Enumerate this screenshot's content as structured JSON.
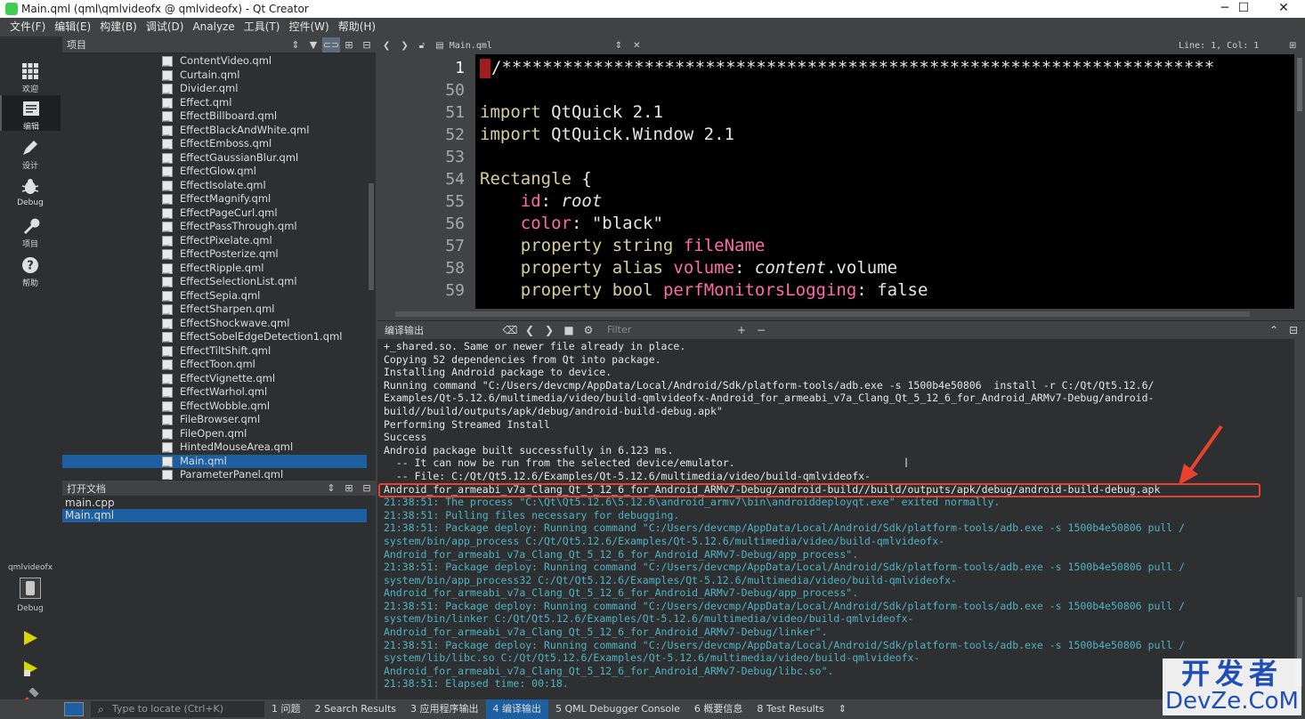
{
  "window": {
    "title": "Main.qml (qml\\qmlvideofx @ qmlvideofx) - Qt Creator",
    "minimize": "─",
    "maximize": "☐",
    "close": "✕"
  },
  "menu": [
    "文件(F)",
    "编辑(E)",
    "构建(B)",
    "调试(D)",
    "Analyze",
    "工具(T)",
    "控件(W)",
    "帮助(H)"
  ],
  "modes": [
    {
      "label": "欢迎",
      "icon": "welcome-grid-icon"
    },
    {
      "label": "编辑",
      "icon": "edit-document-icon"
    },
    {
      "label": "设计",
      "icon": "design-pen-icon"
    },
    {
      "label": "Debug",
      "icon": "debug-bug-icon"
    },
    {
      "label": "项目",
      "icon": "projects-wrench-icon"
    },
    {
      "label": "帮助",
      "icon": "help-question-icon"
    }
  ],
  "kit": {
    "project": "qmlvideofx",
    "mode": "Debug"
  },
  "projects_panel": {
    "title": "项目",
    "files": [
      "ContentVideo.qml",
      "Curtain.qml",
      "Divider.qml",
      "Effect.qml",
      "EffectBillboard.qml",
      "EffectBlackAndWhite.qml",
      "EffectEmboss.qml",
      "EffectGaussianBlur.qml",
      "EffectGlow.qml",
      "EffectIsolate.qml",
      "EffectMagnify.qml",
      "EffectPageCurl.qml",
      "EffectPassThrough.qml",
      "EffectPixelate.qml",
      "EffectPosterize.qml",
      "EffectRipple.qml",
      "EffectSelectionList.qml",
      "EffectSepia.qml",
      "EffectSharpen.qml",
      "EffectShockwave.qml",
      "EffectSobelEdgeDetection1.qml",
      "EffectTiltShift.qml",
      "EffectToon.qml",
      "EffectVignette.qml",
      "EffectWarhol.qml",
      "EffectWobble.qml",
      "FileBrowser.qml",
      "FileOpen.qml",
      "HintedMouseArea.qml",
      "Main.qml",
      "ParameterPanel.qml"
    ],
    "selected": "Main.qml"
  },
  "open_docs": {
    "title": "打开文档",
    "docs": [
      "main.cpp",
      "Main.qml"
    ],
    "selected": "Main.qml"
  },
  "editor": {
    "file": "Main.qml",
    "position": "Line: 1, Col: 1",
    "line_numbers": [
      "1",
      "50",
      "51",
      "52",
      "53",
      "54",
      "55",
      "56",
      "57",
      "58",
      "59"
    ],
    "first_line_text": "/**********************************************************************",
    "code": {
      "import1_kw": "import",
      "import1_rest": " QtQuick 2.1",
      "import2_kw": "import",
      "import2_rest": " QtQuick.Window 2.1",
      "rect_kw": "Rectangle",
      "rect_rest": " {",
      "id_prop": "id",
      "id_val": "root",
      "color_prop": "color",
      "color_val": "\"black\"",
      "p1_kw": "property",
      "p1_type": "string",
      "p1_name": "fileName",
      "p2_kw": "property",
      "p2_type": "alias",
      "p2_name": "volume",
      "p2_val_obj": "content",
      "p2_val_rest": ".volume",
      "p3_kw": "property",
      "p3_type": "bool",
      "p3_name": "perfMonitorsLogging",
      "p3_val": "false"
    }
  },
  "output": {
    "title": "编译输出",
    "filter_placeholder": "Filter",
    "lines": [
      {
        "t": "+_shared.so. Same or newer file already in place.",
        "c": "w"
      },
      {
        "t": "Copying 52 dependencies from Qt into package.",
        "c": "w"
      },
      {
        "t": "Installing Android package to device.",
        "c": "w"
      },
      {
        "t": "Running command \"C:/Users/devcmp/AppData/Local/Android/Sdk/platform-tools/adb.exe -s 1500b4e50806  install -r C:/Qt/Qt5.12.6/",
        "c": "w"
      },
      {
        "t": "Examples/Qt-5.12.6/multimedia/video/build-qmlvideofx-Android_for_armeabi_v7a_Clang_Qt_5_12_6_for_Android_ARMv7-Debug/android-",
        "c": "w"
      },
      {
        "t": "build//build/outputs/apk/debug/android-build-debug.apk\"",
        "c": "w"
      },
      {
        "t": "Performing Streamed Install",
        "c": "w"
      },
      {
        "t": "Success",
        "c": "w"
      },
      {
        "t": "Android package built successfully in 6.123 ms.",
        "c": "w"
      },
      {
        "t": "  -- It can now be run from the selected device/emulator.",
        "c": "w"
      },
      {
        "t": "  -- File: C:/Qt/Qt5.12.6/Examples/Qt-5.12.6/multimedia/video/build-qmlvideofx-",
        "c": "w"
      },
      {
        "t": "Android_for_armeabi_v7a_Clang_Qt_5_12_6_for_Android_ARMv7-Debug/android-build//build/outputs/apk/debug/android-build-debug.apk",
        "c": "w"
      },
      {
        "t": "21:38:51: The process \"C:\\Qt\\Qt5.12.6\\5.12.6\\android_armv7\\bin\\androiddeployqt.exe\" exited normally.",
        "c": "c"
      },
      {
        "t": "21:38:51: Pulling files necessary for debugging.",
        "c": "c"
      },
      {
        "t": "21:38:51: Package deploy: Running command \"C:/Users/devcmp/AppData/Local/Android/Sdk/platform-tools/adb.exe -s 1500b4e50806 pull /",
        "c": "c"
      },
      {
        "t": "system/bin/app_process C:/Qt/Qt5.12.6/Examples/Qt-5.12.6/multimedia/video/build-qmlvideofx-",
        "c": "c"
      },
      {
        "t": "Android_for_armeabi_v7a_Clang_Qt_5_12_6_for_Android_ARMv7-Debug/app_process\".",
        "c": "c"
      },
      {
        "t": "21:38:51: Package deploy: Running command \"C:/Users/devcmp/AppData/Local/Android/Sdk/platform-tools/adb.exe -s 1500b4e50806 pull /",
        "c": "c"
      },
      {
        "t": "system/bin/app_process32 C:/Qt/Qt5.12.6/Examples/Qt-5.12.6/multimedia/video/build-qmlvideofx-",
        "c": "c"
      },
      {
        "t": "Android_for_armeabi_v7a_Clang_Qt_5_12_6_for_Android_ARMv7-Debug/app_process\".",
        "c": "c"
      },
      {
        "t": "21:38:51: Package deploy: Running command \"C:/Users/devcmp/AppData/Local/Android/Sdk/platform-tools/adb.exe -s 1500b4e50806 pull /",
        "c": "c"
      },
      {
        "t": "system/bin/linker C:/Qt/Qt5.12.6/Examples/Qt-5.12.6/multimedia/video/build-qmlvideofx-",
        "c": "c"
      },
      {
        "t": "Android_for_armeabi_v7a_Clang_Qt_5_12_6_for_Android_ARMv7-Debug/linker\".",
        "c": "c"
      },
      {
        "t": "21:38:51: Package deploy: Running command \"C:/Users/devcmp/AppData/Local/Android/Sdk/platform-tools/adb.exe -s 1500b4e50806 pull /",
        "c": "c"
      },
      {
        "t": "system/lib/libc.so C:/Qt/Qt5.12.6/Examples/Qt-5.12.6/multimedia/video/build-qmlvideofx-",
        "c": "c"
      },
      {
        "t": "Android_for_armeabi_v7a_Clang_Qt_5_12_6_for_Android_ARMv7-Debug/libc.so\".",
        "c": "c"
      },
      {
        "t": "21:38:51: Elapsed time: 00:18.",
        "c": "c"
      }
    ]
  },
  "statusbar": {
    "locator_placeholder": "Type to locate (Ctrl+K)",
    "tabs": [
      "1  问题",
      "2  Search Results",
      "3  应用程序输出",
      "4  编译输出",
      "5  QML Debugger Console",
      "6  概要信息",
      "8  Test Results"
    ],
    "selected_tab": "4  编译输出"
  },
  "watermark": {
    "line1": "开发者",
    "line2": "DevZe.CoM"
  },
  "colors": {
    "selection": "#1d5fa0",
    "highlight_box": "#e8422f",
    "output_cyan": "#4fb3c6",
    "keyword": "#d6cf9a",
    "property_name": "#ff6aad"
  }
}
